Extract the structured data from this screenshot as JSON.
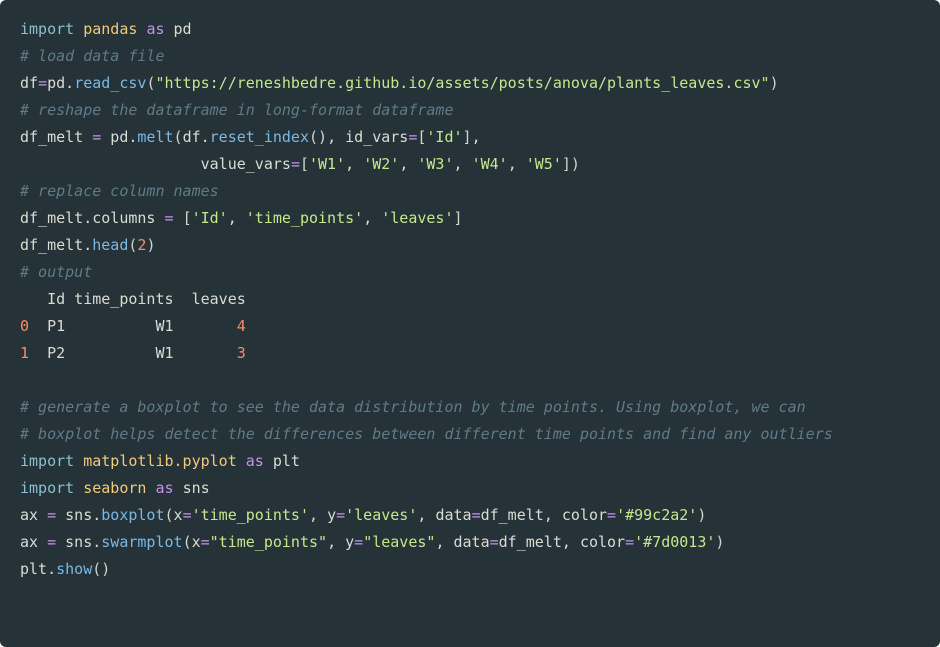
{
  "lines": {
    "l1_import": "import",
    "l1_mod": "pandas",
    "l1_as": "as",
    "l1_alias": "pd",
    "l2_comment": "# load data file",
    "l3_lhs": "df",
    "l3_eq": "=",
    "l3_obj": "pd",
    "l3_dot": ".",
    "l3_fn": "read_csv",
    "l3_po": "(",
    "l3_str": "\"https://reneshbedre.github.io/assets/posts/anova/plants_leaves.csv\"",
    "l3_pc": ")",
    "l4_comment": "# reshape the dataframe in long-format dataframe",
    "l5_lhs": "df_melt ",
    "l5_eq": "=",
    "l5_sp": " pd",
    "l5_dot": ".",
    "l5_fn": "melt",
    "l5_po": "(",
    "l5_arg": "df",
    "l5_dot2": ".",
    "l5_fn2": "reset_index",
    "l5_po2": "(",
    "l5_pc2": ")",
    "l5_comma": ", ",
    "l5_kwarg": "id_vars",
    "l5_eq2": "=",
    "l5_bo": "[",
    "l5_str": "'Id'",
    "l5_bc": "]",
    "l5_comma2": ",",
    "l6_indent": "                    ",
    "l6_kwarg": "value_vars",
    "l6_eq": "=",
    "l6_bo": "[",
    "l6_s1": "'W1'",
    "l6_c1": ", ",
    "l6_s2": "'W2'",
    "l6_c2": ", ",
    "l6_s3": "'W3'",
    "l6_c3": ", ",
    "l6_s4": "'W4'",
    "l6_c4": ", ",
    "l6_s5": "'W5'",
    "l6_bc": "]",
    "l6_pc": ")",
    "l7_comment": "# replace column names",
    "l8_lhs": "df_melt",
    "l8_dot": ".",
    "l8_attr": "columns ",
    "l8_eq": "=",
    "l8_sp": " ",
    "l8_bo": "[",
    "l8_s1": "'Id'",
    "l8_c1": ", ",
    "l8_s2": "'time_points'",
    "l8_c2": ", ",
    "l8_s3": "'leaves'",
    "l8_bc": "]",
    "l9_lhs": "df_melt",
    "l9_dot": ".",
    "l9_fn": "head",
    "l9_po": "(",
    "l9_num": "2",
    "l9_pc": ")",
    "l10_comment": "# output",
    "outhdr": "   Id time_points  leaves",
    "outr0_idx": "0",
    "outr0_row": "  P1          W1       ",
    "outr0_val": "4",
    "outr1_idx": "1",
    "outr1_row": "  P2          W1       ",
    "outr1_val": "3",
    "l14_comment": "# generate a boxplot to see the data distribution by time points. Using boxplot, we can ",
    "l15_comment": "# boxplot helps detect the differences between different time points and find any outliers",
    "l16_import": "import",
    "l16_mod": "matplotlib.pyplot",
    "l16_as": "as",
    "l16_alias": "plt",
    "l17_import": "import",
    "l17_mod": "seaborn",
    "l17_as": "as",
    "l17_alias": "sns",
    "l18_lhs": "ax ",
    "l18_eq": "=",
    "l18_sp": " sns",
    "l18_dot": ".",
    "l18_fn": "boxplot",
    "l18_po": "(",
    "l18_k1": "x",
    "l18_e1": "=",
    "l18_s1": "'time_points'",
    "l18_c1": ", ",
    "l18_k2": "y",
    "l18_e2": "=",
    "l18_s2": "'leaves'",
    "l18_c2": ", ",
    "l18_k3": "data",
    "l18_e3": "=",
    "l18_v3": "df_melt",
    "l18_c3": ", ",
    "l18_k4": "color",
    "l18_e4": "=",
    "l18_s4": "'#99c2a2'",
    "l18_pc": ")",
    "l19_lhs": "ax ",
    "l19_eq": "=",
    "l19_sp": " sns",
    "l19_dot": ".",
    "l19_fn": "swarmplot",
    "l19_po": "(",
    "l19_k1": "x",
    "l19_e1": "=",
    "l19_s1": "\"time_points\"",
    "l19_c1": ", ",
    "l19_k2": "y",
    "l19_e2": "=",
    "l19_s2": "\"leaves\"",
    "l19_c2": ", ",
    "l19_k3": "data",
    "l19_e3": "=",
    "l19_v3": "df_melt",
    "l19_c3": ", ",
    "l19_k4": "color",
    "l19_e4": "=",
    "l19_s4": "'#7d0013'",
    "l19_pc": ")",
    "l20_lhs": "plt",
    "l20_dot": ".",
    "l20_fn": "show",
    "l20_po": "(",
    "l20_pc": ")"
  }
}
